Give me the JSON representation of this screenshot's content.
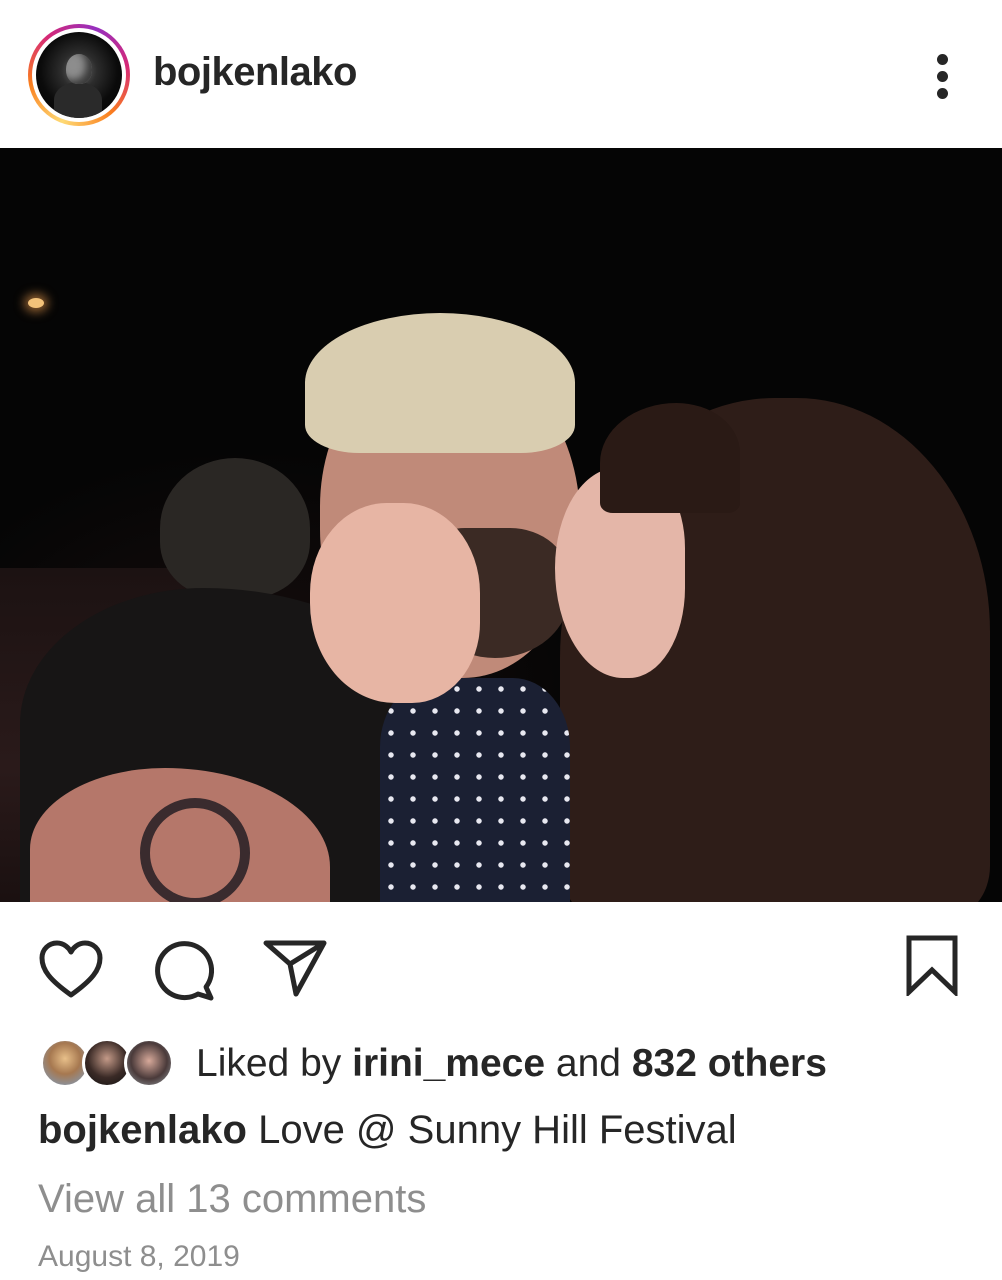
{
  "post": {
    "username": "bojkenlako",
    "avatar_icon": "profile-avatar",
    "more_icon": "more-vertical-icon",
    "photo_alt": "photo"
  },
  "actions": {
    "like_icon": "heart-icon",
    "comment_icon": "comment-icon",
    "share_icon": "share-send-icon",
    "save_icon": "bookmark-icon"
  },
  "likes": {
    "prefix": "Liked by",
    "first_liker": "irini_mece",
    "connector": "and",
    "others": "832 others"
  },
  "caption": {
    "username": "bojkenlako",
    "text": "Love @ Sunny Hill Festival"
  },
  "comments": {
    "view_all": "View all 13 comments"
  },
  "date": "August 8, 2019",
  "colors": {
    "text": "#262626",
    "muted": "#8e8e8e",
    "story_ring": [
      "#feda75",
      "#fa7e1e",
      "#d62976",
      "#962fbf"
    ]
  }
}
